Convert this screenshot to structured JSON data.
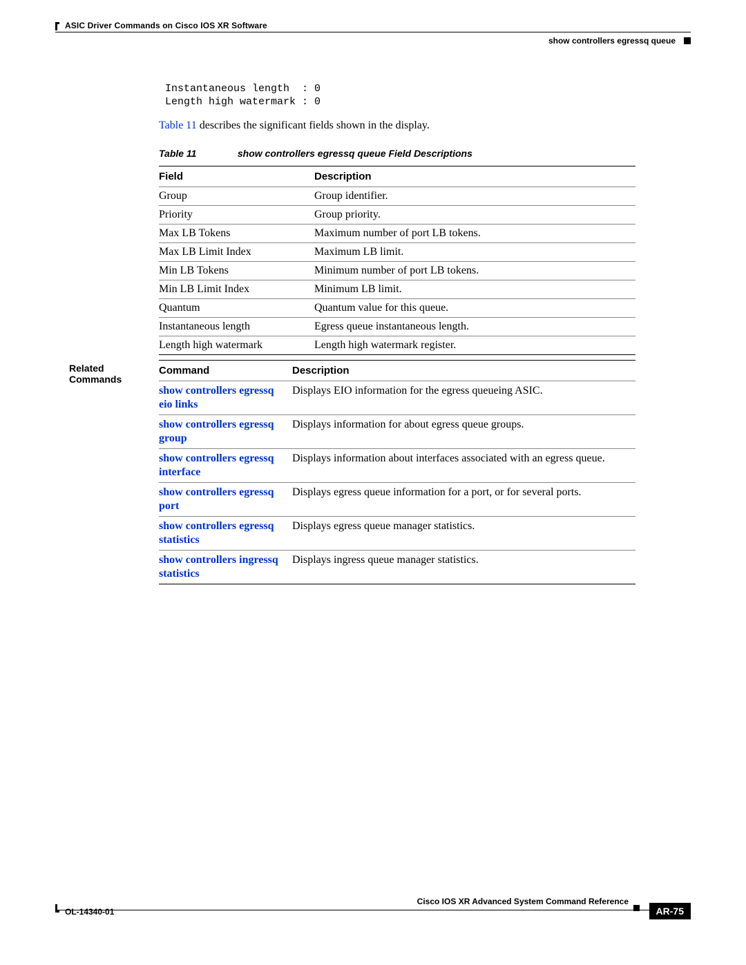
{
  "header": {
    "chapter_title": "ASIC Driver Commands on Cisco IOS XR Software",
    "topic_title": "show controllers egressq queue"
  },
  "output_block": " Instantaneous length  : 0\n Length high watermark : 0",
  "intro": {
    "xref": "Table 11",
    "rest": " describes the significant fields shown in the display."
  },
  "table_caption": {
    "number": "Table 11",
    "title": "show controllers egressq queue Field Descriptions"
  },
  "fields_table": {
    "headers": {
      "field": "Field",
      "description": "Description"
    },
    "rows": [
      {
        "field": "Group",
        "desc": "Group identifier."
      },
      {
        "field": "Priority",
        "desc": "Group priority."
      },
      {
        "field": "Max LB Tokens",
        "desc": "Maximum number of port LB tokens."
      },
      {
        "field": "Max LB Limit Index",
        "desc": "Maximum LB limit."
      },
      {
        "field": "Min LB Tokens",
        "desc": "Minimum number of port LB tokens."
      },
      {
        "field": "Min LB Limit Index",
        "desc": "Minimum LB limit."
      },
      {
        "field": "Quantum",
        "desc": "Quantum value for this queue."
      },
      {
        "field": "Instantaneous length",
        "desc": "Egress queue instantaneous length."
      },
      {
        "field": "Length high watermark",
        "desc": "Length high watermark register."
      }
    ]
  },
  "related": {
    "section_label": "Related Commands",
    "headers": {
      "command": "Command",
      "description": "Description"
    },
    "rows": [
      {
        "cmd": "show controllers egressq eio links",
        "desc": "Displays EIO information for the egress queueing ASIC."
      },
      {
        "cmd": "show controllers egressq group",
        "desc": "Displays information for about egress queue groups."
      },
      {
        "cmd": "show controllers egressq interface",
        "desc": "Displays information about interfaces associated with an egress queue."
      },
      {
        "cmd": "show controllers egressq port",
        "desc": "Displays egress queue information for a port, or for several ports."
      },
      {
        "cmd": "show controllers egressq statistics",
        "desc": "Displays egress queue manager statistics."
      },
      {
        "cmd": "show controllers ingressq statistics",
        "desc": "Displays ingress queue manager statistics."
      }
    ]
  },
  "footer": {
    "book_title": "Cisco IOS XR Advanced System Command Reference",
    "doc_id": "OL-14340-01",
    "page_number": "AR-75"
  }
}
